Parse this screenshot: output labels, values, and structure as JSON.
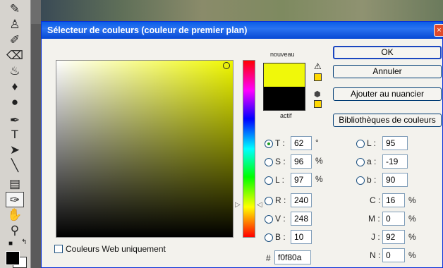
{
  "dialog": {
    "title": "Sélecteur de couleurs (couleur de premier plan)",
    "close_glyph": "×"
  },
  "swatches": {
    "new_label": "nouveau",
    "current_label": "actif",
    "new_color": "#f0f80a",
    "current_color": "#000000",
    "warning_icon": "warning-triangle-icon",
    "gamut_icon": "cube-icon"
  },
  "buttons": {
    "ok": "OK",
    "cancel": "Annuler",
    "add_swatch": "Ajouter au nuancier",
    "libraries": "Bibliothèques de couleurs"
  },
  "hsb": [
    {
      "label": "T :",
      "value": "62",
      "unit": "°",
      "selected": true
    },
    {
      "label": "S :",
      "value": "96",
      "unit": "%",
      "selected": false
    },
    {
      "label": "L :",
      "value": "97",
      "unit": "%",
      "selected": false
    }
  ],
  "rgb": [
    {
      "label": "R :",
      "value": "240"
    },
    {
      "label": "V :",
      "value": "248"
    },
    {
      "label": "B :",
      "value": "10"
    }
  ],
  "lab": [
    {
      "label": "L :",
      "value": "95"
    },
    {
      "label": "a :",
      "value": "-19"
    },
    {
      "label": "b :",
      "value": "90"
    }
  ],
  "cmyk": [
    {
      "label": "C :",
      "value": "16",
      "unit": "%"
    },
    {
      "label": "M :",
      "value": "0",
      "unit": "%"
    },
    {
      "label": "J :",
      "value": "92",
      "unit": "%"
    },
    {
      "label": "N :",
      "value": "0",
      "unit": "%"
    }
  ],
  "web_only": {
    "label": "Couleurs Web uniquement",
    "checked": false
  },
  "hex": {
    "prefix": "#",
    "value": "f0f80a"
  }
}
